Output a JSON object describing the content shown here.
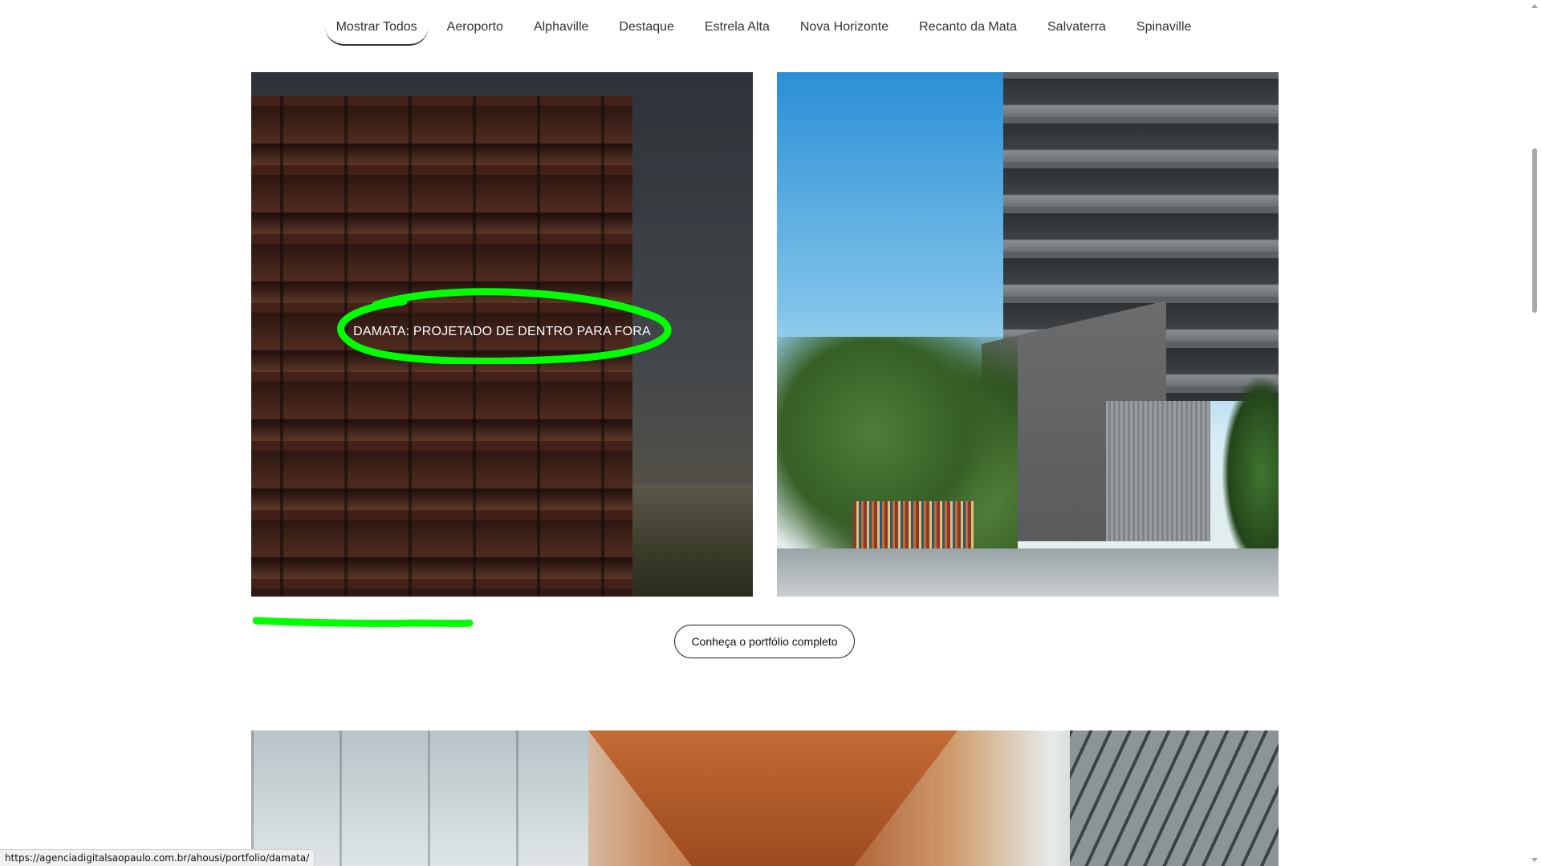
{
  "filters": {
    "items": [
      {
        "label": "Mostrar Todos",
        "active": true
      },
      {
        "label": "Aeroporto",
        "active": false
      },
      {
        "label": "Alphaville",
        "active": false
      },
      {
        "label": "Destaque",
        "active": false
      },
      {
        "label": "Estrela Alta",
        "active": false
      },
      {
        "label": "Nova Horizonte",
        "active": false
      },
      {
        "label": "Recanto da Mata",
        "active": false
      },
      {
        "label": "Salvaterra",
        "active": false
      },
      {
        "label": "Spinaville",
        "active": false
      }
    ]
  },
  "portfolio": {
    "cards": [
      {
        "title": "DAMATA: PROJETADO DE DENTRO PARA FORA",
        "hovered": true
      },
      {
        "title": "",
        "hovered": false
      }
    ],
    "button_label": "Conheça o portfólio completo"
  },
  "annotations": {
    "color": "#00ff00"
  },
  "status_bar": {
    "url": "https://agenciadigitalsaopaulo.com.br/ahousi/portfolio/damata/"
  }
}
